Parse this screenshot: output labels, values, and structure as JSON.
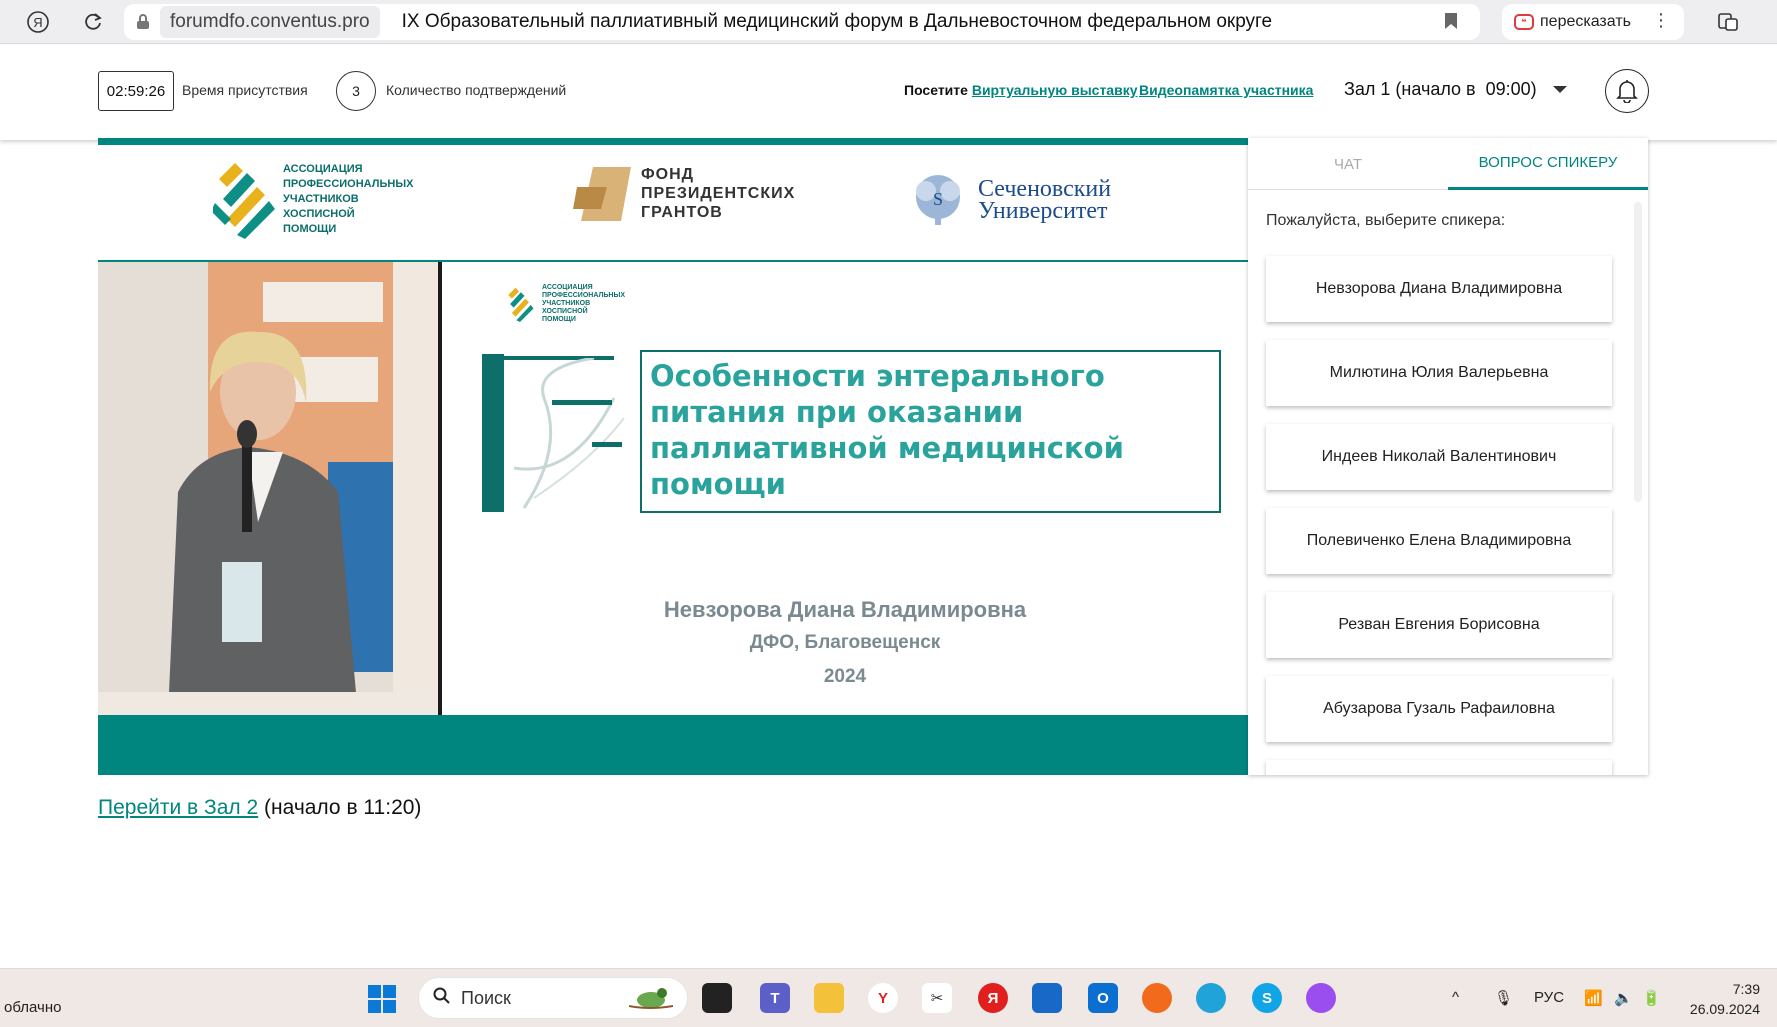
{
  "browser": {
    "host": "forumdfo.conventus.pro",
    "page_title": "IX Образовательный паллиативный медицинский форум в Дальневосточном федеральном округе",
    "retell_label": "пересказать"
  },
  "header": {
    "timer": "02:59:26",
    "presence_label": "Время присутствия",
    "confirmations_count": "3",
    "confirmations_label": "Количество подтверждений",
    "visit_prefix": "Посетите",
    "virtual_expo_link": "Виртуальную выставку",
    "video_memo_link": "Видеопамятка участника",
    "hall_select": "Зал 1 (начало в  09:00)"
  },
  "video": {
    "logo_a": "АССОЦИАЦИЯ ПРОФЕССИОНАЛЬНЫХ УЧАСТНИКОВ ХОСПИСНОЙ ПОМОЩИ",
    "logo_b_line1": "ФОНД",
    "logo_b_line2": "ПРЕЗИДЕНТСКИХ",
    "logo_b_line3": "ГРАНТОВ",
    "logo_c_line1": "Сеченовский",
    "logo_c_line2": "Университет",
    "slide_logo": "АССОЦИАЦИЯ ПРОФЕССИОНАЛЬНЫХ УЧАСТНИКОВ ХОСПИСНОЙ ПОМОЩИ",
    "slide_title": "Особенности энтерального питания при оказании паллиативной медицинской помощи",
    "slide_speaker": "Невзорова Диана Владимировна",
    "slide_location": "ДФО, Благовещенск",
    "slide_year": "2024"
  },
  "panel": {
    "tab_chat": "ЧАТ",
    "tab_question": "ВОПРОС СПИКЕРУ",
    "prompt": "Пожалуйста, выберите спикера:",
    "speakers": [
      "Невзорова Диана Владимировна",
      "Милютина Юлия Валерьевна",
      "Индеев Николай Валентинович",
      "Полевиченко Елена Владимировна",
      "Резван Евгения Борисовна",
      "Абузарова Гузаль Рафаиловна"
    ]
  },
  "hall_link": {
    "link": "Перейти в Зал 2",
    "suffix": " (начало в 11:20)"
  },
  "taskbar": {
    "weather": "облачно",
    "search": "Поиск",
    "lang": "РУС",
    "time": "7:39",
    "date": "26.09.2024"
  },
  "colors": {
    "accent": "#00857f",
    "slide_title": "#2aa39c"
  }
}
